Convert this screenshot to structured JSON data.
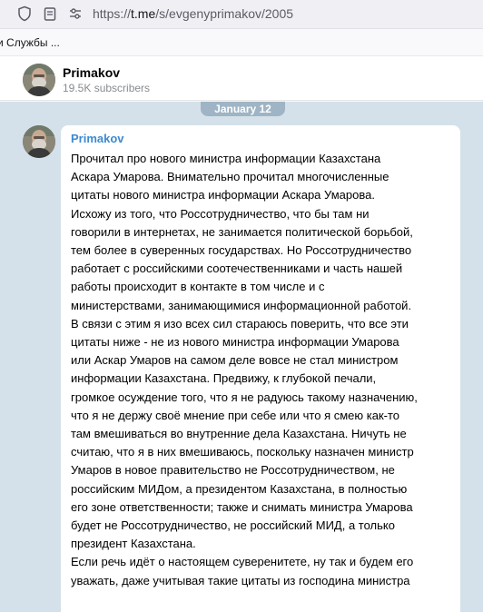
{
  "browser": {
    "url_scheme": "https://",
    "url_host": "t.me",
    "url_path": "/s/evgenyprimakov/2005",
    "bookmark_label": "и Службы ..."
  },
  "channel": {
    "title": "Primakov",
    "subscribers": "19.5K subscribers"
  },
  "feed": {
    "date_label": "January 12",
    "message": {
      "author": "Primakov",
      "lines": [
        "Прочитал про нового министра информации Казахстана",
        "Аскара Умарова. Внимательно прочитал многочисленные",
        "цитаты нового министра информации Аскара Умарова.",
        "Исхожу из того, что Россотрудничество, что бы там ни",
        "говорили в интернетах, не занимается политической борьбой,",
        "тем более в суверенных государствах. Но Россотрудничество",
        "работает с российскими соотечественниками и часть нашей",
        "работы происходит в контакте в том числе и с",
        "министерствами, занимающимися информационной работой.",
        "В связи с этим я изо всех сил стараюсь поверить, что все эти",
        "цитаты ниже - не из нового министра информации Умарова",
        "или Аскар Умаров на самом деле вовсе не стал министром",
        "информации Казахстана. Предвижу, к глубокой печали,",
        "громкое осуждение того, что я не радуюсь такому назначению,",
        "что я не держу своё мнение при себе или что я смею как-то",
        "там вмешиваться во внутренние дела Казахстана. Ничуть не",
        "считаю, что я в них вмешиваюсь, поскольку назначен министр",
        "Умаров в новое правительство не Россотрудничеством, не",
        "российским МИДом, а президентом Казахстана, в полностью",
        "его зоне ответственности; также и снимать министра Умарова",
        "будет не Россотрудничество, не российский МИД, а только",
        "президент Казахстана.",
        "Если речь идёт о настоящем суверенитете, ну так и будем его",
        "уважать, даже учитывая такие цитаты из господина министра"
      ]
    }
  },
  "colors": {
    "link_author": "#3d8ad0",
    "chat_background": "#d4e1ea",
    "date_pill": "#9fb4c4"
  },
  "icons": [
    "shield-icon",
    "page-info-icon",
    "site-settings-icon"
  ]
}
